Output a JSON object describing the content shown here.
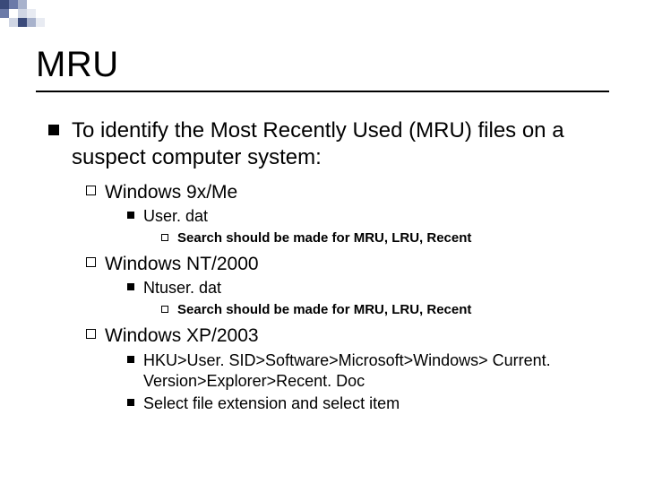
{
  "title": "MRU",
  "main_point": "To identify the Most Recently Used (MRU) files on a suspect computer system:",
  "sections": [
    {
      "os": "Windows 9x/Me",
      "file": "User. dat",
      "note": "Search should be made for MRU, LRU, Recent"
    },
    {
      "os": "Windows NT/2000",
      "file": "Ntuser. dat",
      "note": "Search should be made for MRU, LRU, Recent"
    },
    {
      "os": "Windows XP/2003",
      "steps": [
        "HKU>User. SID>Software>Microsoft>Windows> Current. Version>Explorer>Recent. Doc",
        "Select file extension and select item"
      ]
    }
  ]
}
